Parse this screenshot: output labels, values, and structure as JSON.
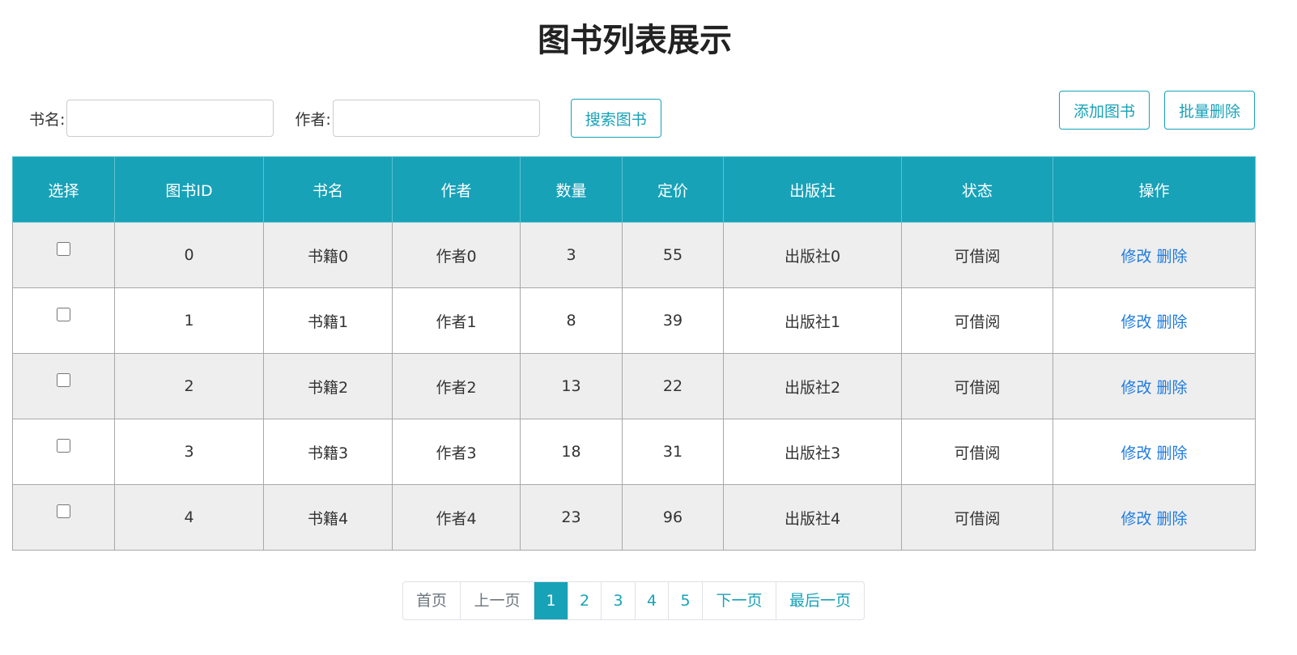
{
  "page": {
    "title": "图书列表展示"
  },
  "search": {
    "name_label": "书名:",
    "name_value": "",
    "author_label": "作者:",
    "author_value": "",
    "search_label": "搜索图书"
  },
  "toolbar": {
    "add_label": "添加图书",
    "batch_delete_label": "批量删除"
  },
  "table": {
    "headers": [
      "选择",
      "图书ID",
      "书名",
      "作者",
      "数量",
      "定价",
      "出版社",
      "状态",
      "操作"
    ],
    "rows": [
      {
        "checked": false,
        "id": "0",
        "name": "书籍0",
        "author": "作者0",
        "count": "3",
        "price": "55",
        "publisher": "出版社0",
        "status": "可借阅",
        "edit": "修改",
        "delete": "删除"
      },
      {
        "checked": false,
        "id": "1",
        "name": "书籍1",
        "author": "作者1",
        "count": "8",
        "price": "39",
        "publisher": "出版社1",
        "status": "可借阅",
        "edit": "修改",
        "delete": "删除"
      },
      {
        "checked": false,
        "id": "2",
        "name": "书籍2",
        "author": "作者2",
        "count": "13",
        "price": "22",
        "publisher": "出版社2",
        "status": "可借阅",
        "edit": "修改",
        "delete": "删除"
      },
      {
        "checked": false,
        "id": "3",
        "name": "书籍3",
        "author": "作者3",
        "count": "18",
        "price": "31",
        "publisher": "出版社3",
        "status": "可借阅",
        "edit": "修改",
        "delete": "删除"
      },
      {
        "checked": false,
        "id": "4",
        "name": "书籍4",
        "author": "作者4",
        "count": "23",
        "price": "96",
        "publisher": "出版社4",
        "status": "可借阅",
        "edit": "修改",
        "delete": "删除"
      }
    ]
  },
  "pagination": {
    "first": "首页",
    "prev": "上一页",
    "pages": [
      "1",
      "2",
      "3",
      "4",
      "5"
    ],
    "active_page": "1",
    "next": "下一页",
    "last": "最后一页"
  },
  "colors": {
    "accent": "#17a2b8",
    "link": "#1e7be0",
    "row_stripe": "#eeeeee"
  }
}
